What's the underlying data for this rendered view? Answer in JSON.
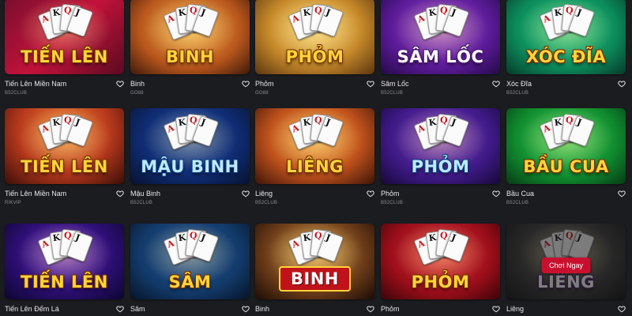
{
  "games": [
    {
      "name": "Tiến Lên Miền Nam",
      "provider": "B52CLUB",
      "art_title": "TIẾN LÊN",
      "bg": "linear-gradient(135deg,#7a0e2e,#c3123a 50%,#5b0a22)",
      "title_style": ""
    },
    {
      "name": "Binh",
      "provider": "GO88",
      "art_title": "BINH",
      "bg": "radial-gradient(ellipse at 50% 40%,#f2b34a,#b8561c 60%,#3e1a0a)",
      "title_style": ""
    },
    {
      "name": "Phỏm",
      "provider": "GO88",
      "art_title": "PHỎM",
      "bg": "radial-gradient(ellipse at 50% 40%,#f7d67a,#c78a2a 55%,#5b3510)",
      "title_style": ""
    },
    {
      "name": "Sâm Lốc",
      "provider": "B52CLUB",
      "art_title": "SÂM LỐC",
      "bg": "radial-gradient(ellipse at 50% 40%,#9b4ad6,#5a1a96 60%,#230a45)",
      "title_style": "white"
    },
    {
      "name": "Xóc Đĩa",
      "provider": "B52CLUB",
      "art_title": "XÓC ĐĨA",
      "bg": "radial-gradient(ellipse at 50% 40%,#2ed08a,#0b8a5a 60%,#063a2a)",
      "title_style": ""
    },
    {
      "name": "Tiến Lên Miền Nam",
      "provider": "RIKVIP",
      "art_title": "TIẾN LÊN",
      "bg": "radial-gradient(ellipse at 50% 30%,#f08a3a,#b6381c 55%,#3a0e08)",
      "title_style": ""
    },
    {
      "name": "Mậu Binh",
      "provider": "B52CLUB",
      "art_title": "MẬU BINH",
      "bg": "radial-gradient(ellipse at 50% 40%,#1e4fae,#0f2a6e 60%,#061230)",
      "title_style": "blue"
    },
    {
      "name": "Liêng",
      "provider": "B52CLUB",
      "art_title": "LIÊNG",
      "bg": "radial-gradient(ellipse at 50% 40%,#f4b04a,#c0521c 55%,#3e1408)",
      "title_style": ""
    },
    {
      "name": "Phỏm",
      "provider": "B52CLUB",
      "art_title": "PHỎM",
      "bg": "radial-gradient(ellipse at 50% 40%,#7a3ac8,#3e1a86 60%,#170838)",
      "title_style": "blue"
    },
    {
      "name": "Bầu Cua",
      "provider": "B52CLUB",
      "art_title": "BẦU CUA",
      "bg": "radial-gradient(ellipse at 50% 40%,#3ad05a,#0f8a2e 60%,#063a14)",
      "title_style": ""
    },
    {
      "name": "Tiến Lên Đếm Lá",
      "provider": "",
      "art_title": "TIẾN LÊN",
      "bg": "radial-gradient(ellipse at 50% 40%,#6a2ad0,#2a0e6e 60%,#0c0630)",
      "title_style": ""
    },
    {
      "name": "Sâm",
      "provider": "",
      "art_title": "SÂM",
      "bg": "radial-gradient(ellipse at 50% 40%,#2a5a9a,#123a6a 60%,#061428)",
      "title_style": ""
    },
    {
      "name": "Binh",
      "provider": "",
      "art_title": "BINH",
      "bg": "radial-gradient(ellipse at 50% 40%,#d8a04a,#6a3a18 60%,#1a0c06)",
      "title_style": "red"
    },
    {
      "name": "Phỏm",
      "provider": "",
      "art_title": "PHỎM",
      "bg": "radial-gradient(ellipse at 50% 40%,#e0303a,#9a0e1a 60%,#3a0408)",
      "title_style": ""
    },
    {
      "name": "Liêng",
      "provider": "",
      "art_title": "LIÊNG",
      "bg": "radial-gradient(ellipse at 50% 40%,#7a7a7a,#3a3a3a 60%,#141414)",
      "title_style": "white",
      "play_label": "Chơi Ngay",
      "dim": true
    }
  ],
  "colors": {
    "background": "#1b1c20",
    "accent": "#c8102e",
    "caption": "#e6e6e8",
    "provider": "#8b8c92"
  },
  "icons": {
    "favorite": "heart-outline-icon"
  }
}
